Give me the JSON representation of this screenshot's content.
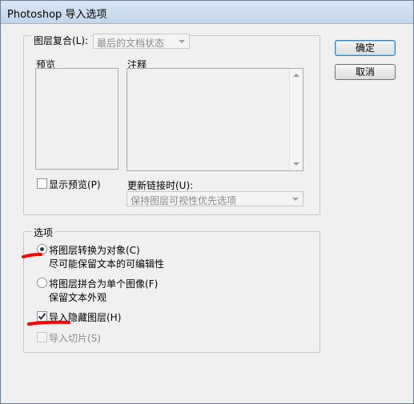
{
  "window": {
    "title": "Photoshop 导入选项"
  },
  "layer_comp": {
    "label": "图层复合(L):",
    "value": "最后的文档状态",
    "preview_label": "预览",
    "comment_label": "注释",
    "show_preview_label": "显示预览(P)",
    "show_preview_checked": false,
    "update_links_label": "更新链接时(U):",
    "update_links_value": "保持图层可视性优先选项"
  },
  "options": {
    "legend": "选项",
    "radio1_label": "将图层转换为对象(C)",
    "radio1_desc": "尽可能保留文本的可编辑性",
    "radio1_checked": true,
    "radio2_label": "将图层拼合为单个图像(F)",
    "radio2_desc": "保留文本外观",
    "radio2_checked": false,
    "import_hidden_label": "导入隐藏图层(H)",
    "import_hidden_checked": true,
    "import_slices_label": "导入切片(S)",
    "import_slices_checked": false
  },
  "buttons": {
    "ok": "确定",
    "cancel": "取消"
  },
  "colors": {
    "annotation_red": "#ff0000",
    "radio_dot": "#1d3b63"
  }
}
